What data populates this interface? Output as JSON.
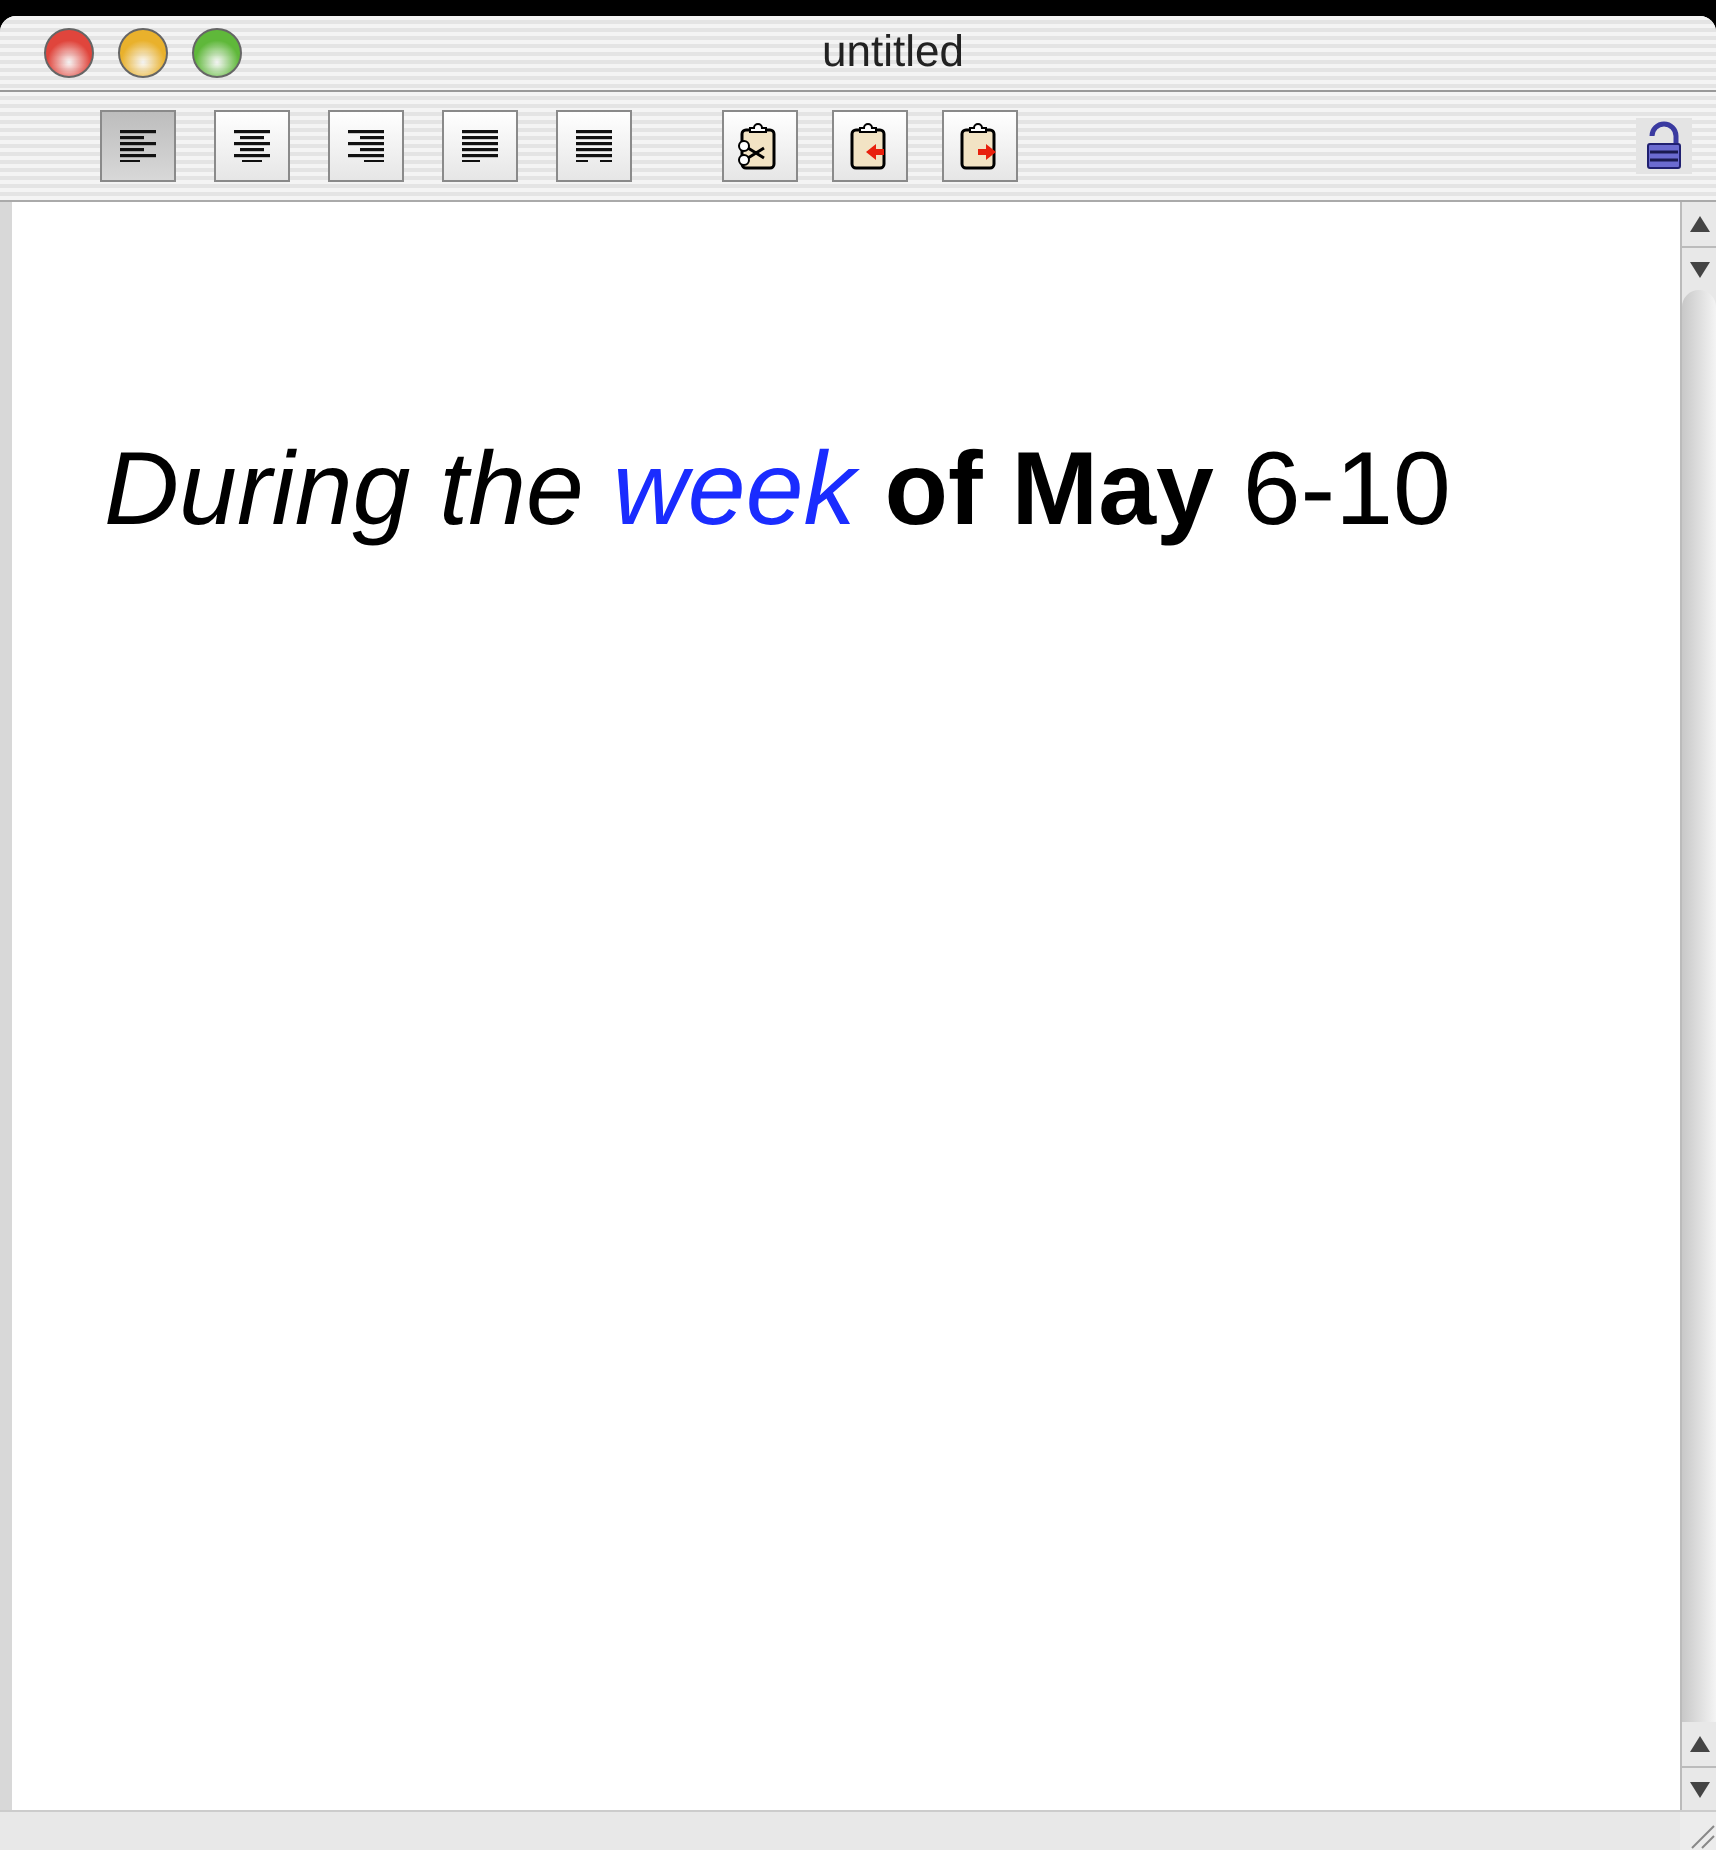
{
  "window": {
    "title": "untitled"
  },
  "toolbar": {
    "alignment": [
      {
        "kind": "left",
        "selected": true
      },
      {
        "kind": "center",
        "selected": false
      },
      {
        "kind": "right",
        "selected": false
      },
      {
        "kind": "justify",
        "selected": false
      },
      {
        "kind": "full",
        "selected": false
      }
    ],
    "clipboard": [
      {
        "kind": "cut"
      },
      {
        "kind": "paste-in"
      },
      {
        "kind": "paste-out"
      }
    ],
    "locked": false
  },
  "document": {
    "segments": [
      {
        "text": "During the",
        "italic": true,
        "bold": false
      },
      {
        "text": "week",
        "italic": true,
        "bold": false,
        "color": "#1a2cff"
      },
      {
        "text": "of May",
        "italic": false,
        "bold": true
      },
      {
        "text": "6-10",
        "italic": false,
        "bold": false
      }
    ]
  }
}
